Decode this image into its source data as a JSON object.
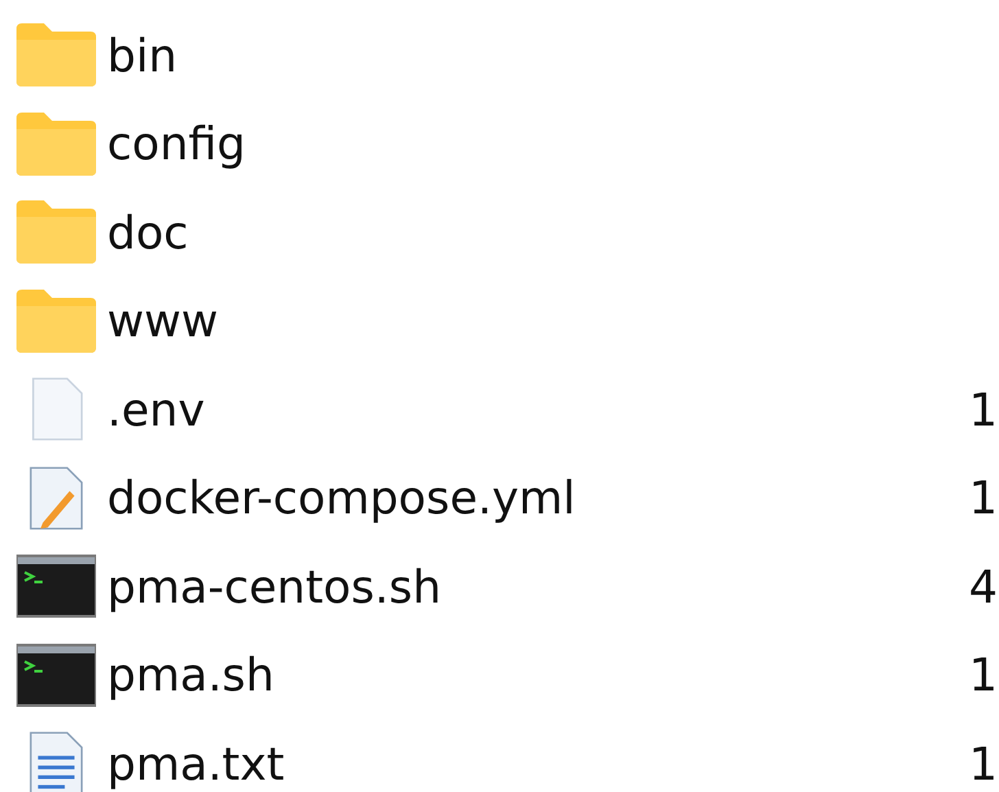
{
  "files": [
    {
      "kind": "folder",
      "name": "bin"
    },
    {
      "kind": "folder",
      "name": "config"
    },
    {
      "kind": "folder",
      "name": "doc"
    },
    {
      "kind": "folder",
      "name": "www"
    },
    {
      "kind": "blank",
      "name": ".env",
      "column_2": "1"
    },
    {
      "kind": "yaml",
      "name": "docker-compose.yml",
      "column_2": "1"
    },
    {
      "kind": "script",
      "name": "pma-centos.sh",
      "column_2": "4"
    },
    {
      "kind": "script",
      "name": "pma.sh",
      "column_2": "1"
    },
    {
      "kind": "text",
      "name": "pma.txt",
      "column_2": "1"
    }
  ]
}
